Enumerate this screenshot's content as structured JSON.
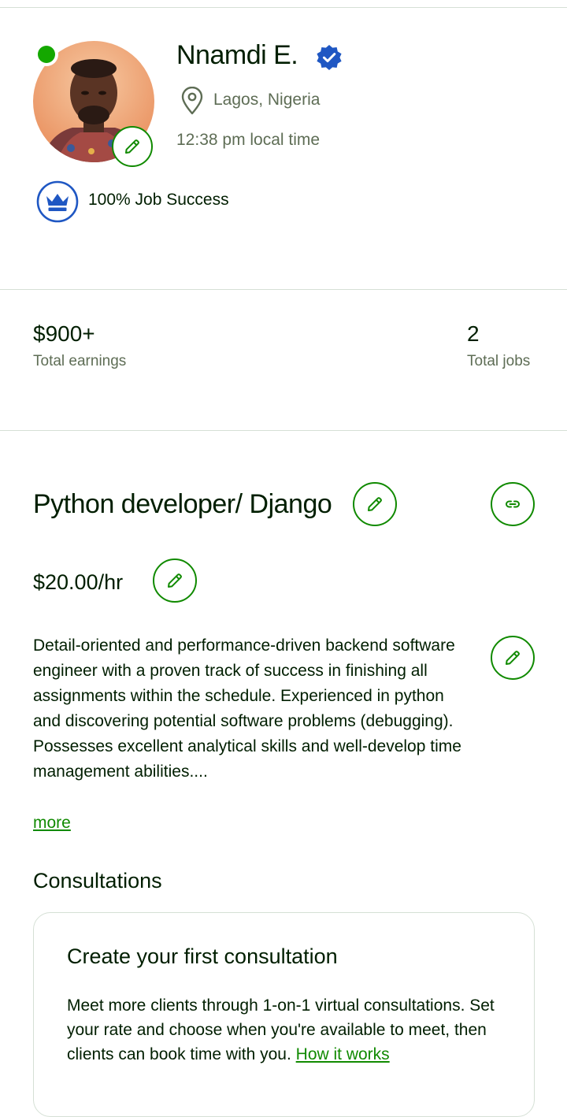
{
  "profile": {
    "name": "Nnamdi E.",
    "location": "Lagos, Nigeria",
    "local_time": "12:38 pm local time",
    "job_success": "100% Job Success",
    "online": true
  },
  "stats": {
    "earnings_value": "$900+",
    "earnings_label": "Total earnings",
    "jobs_value": "2",
    "jobs_label": "Total jobs"
  },
  "specialized": {
    "title": "Python developer/ Django",
    "rate": "$20.00/hr",
    "overview": "Detail-oriented and performance-driven backend software engineer with a proven track of success in finishing all assignments within the schedule. Experienced in python and discovering potential software problems (debugging). Possesses excellent analytical skills and well-develop time management abilities....",
    "more_label": "more"
  },
  "consultations": {
    "heading": "Consultations",
    "card_title": "Create your first consultation",
    "card_body": "Meet more clients through 1-on-1 virtual consultations. Set your rate and choose when you're available to meet, then clients can book time with you.",
    "card_link": "How it works"
  },
  "colors": {
    "brand_green": "#108a00",
    "online_green": "#14a800",
    "verified_blue": "#1f57c3",
    "text_dark": "#001e00",
    "text_muted": "#5e6d55"
  },
  "icons": {
    "edit": "pencil-icon",
    "link": "link-icon",
    "verified": "verified-badge-icon",
    "location": "map-pin-icon",
    "top_rated": "crown-icon"
  }
}
